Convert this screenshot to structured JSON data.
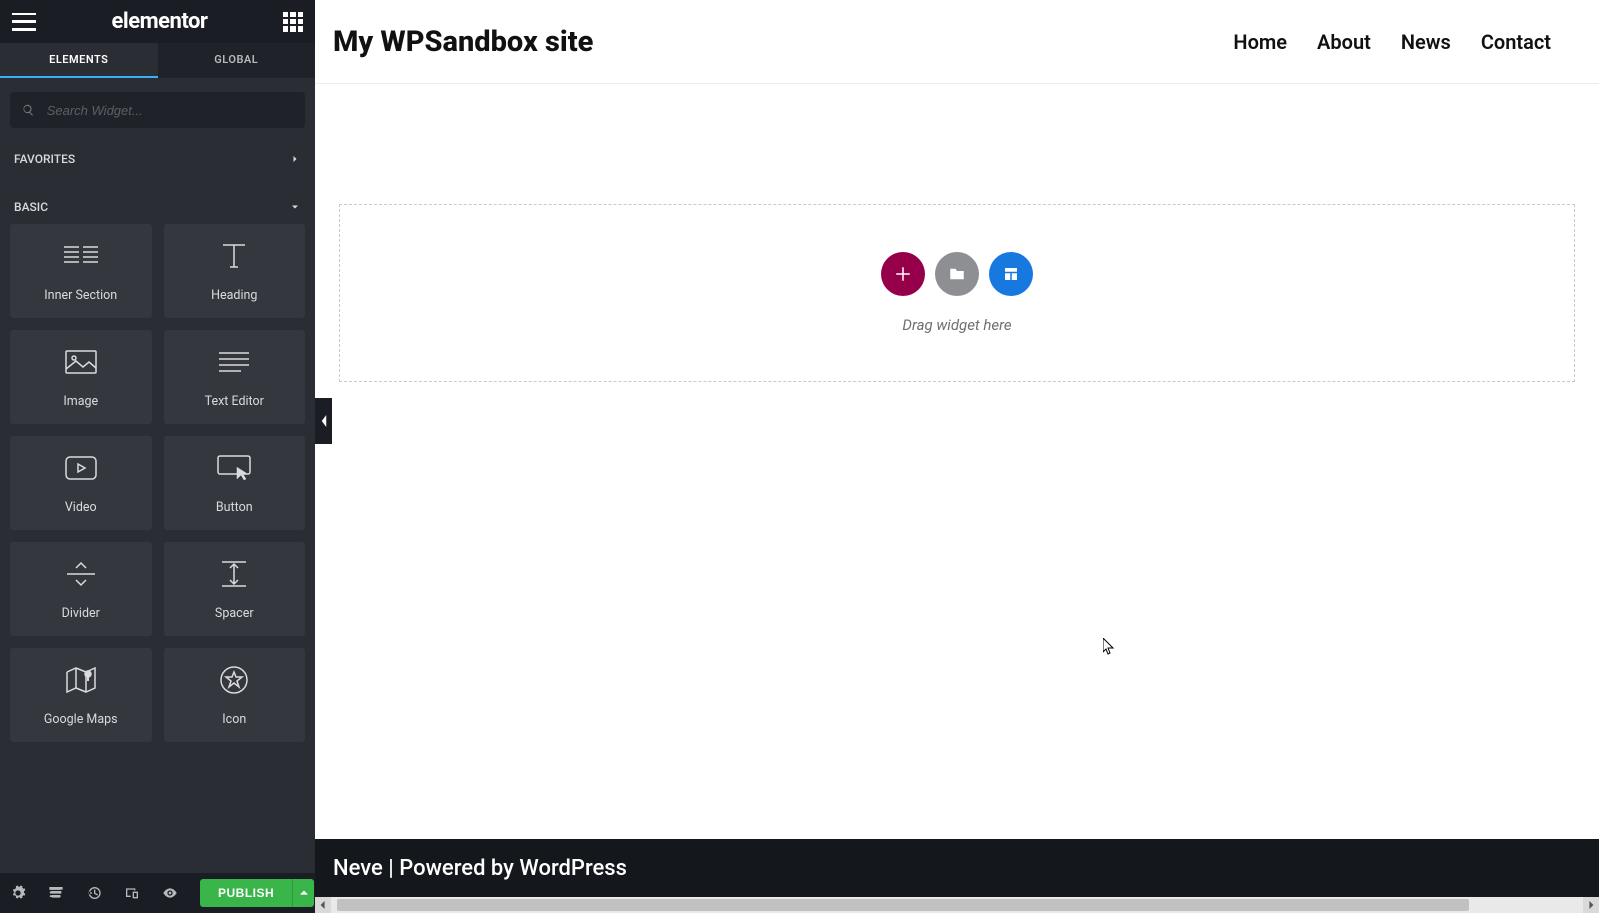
{
  "sidebar": {
    "brand": "elementor",
    "tabs": {
      "elements": "ELEMENTS",
      "global": "GLOBAL"
    },
    "search_placeholder": "Search Widget...",
    "sections": {
      "favorites": "FAVORITES",
      "basic": "BASIC"
    },
    "widgets": [
      {
        "id": "inner-section",
        "label": "Inner Section"
      },
      {
        "id": "heading",
        "label": "Heading"
      },
      {
        "id": "image",
        "label": "Image"
      },
      {
        "id": "text-editor",
        "label": "Text Editor"
      },
      {
        "id": "video",
        "label": "Video"
      },
      {
        "id": "button",
        "label": "Button"
      },
      {
        "id": "divider",
        "label": "Divider"
      },
      {
        "id": "spacer",
        "label": "Spacer"
      },
      {
        "id": "google-maps",
        "label": "Google Maps"
      },
      {
        "id": "icon",
        "label": "Icon"
      }
    ],
    "publish": "PUBLISH"
  },
  "preview": {
    "site_title": "My WPSandbox site",
    "nav": [
      "Home",
      "About",
      "News",
      "Contact"
    ],
    "dropzone_text": "Drag widget here",
    "footer_theme": "Neve",
    "footer_sep": " | ",
    "footer_rest": "Powered by WordPress"
  },
  "colors": {
    "accent_add": "#96004b",
    "accent_folder": "#8e8f92",
    "accent_template": "#1778e0",
    "publish": "#39b54a"
  }
}
